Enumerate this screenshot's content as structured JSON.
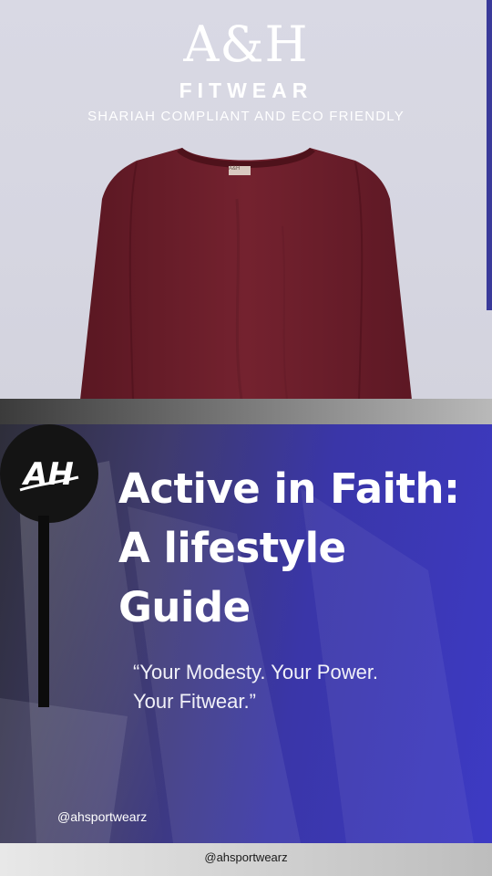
{
  "product": {
    "brand_mark": "A&H",
    "brand_sub": "FITWEAR",
    "tagline": "SHARIAH COMPLIANT AND ECO FRIENDLY",
    "shirt_label": "A&H",
    "shirt_color": "#6e1f2b"
  },
  "banner": {
    "logo_icon": "ah-logo-icon",
    "headline_lines": [
      "Active in Faith:",
      "A lifestyle",
      "Guide"
    ],
    "quote_lines": [
      "“Your Modesty. Your Power.",
      "Your Fitwear.”"
    ],
    "handle": "@ahsportwearz",
    "accent_color": "#3d3ac4"
  },
  "footer": {
    "handle": "@ahsportwearz"
  }
}
